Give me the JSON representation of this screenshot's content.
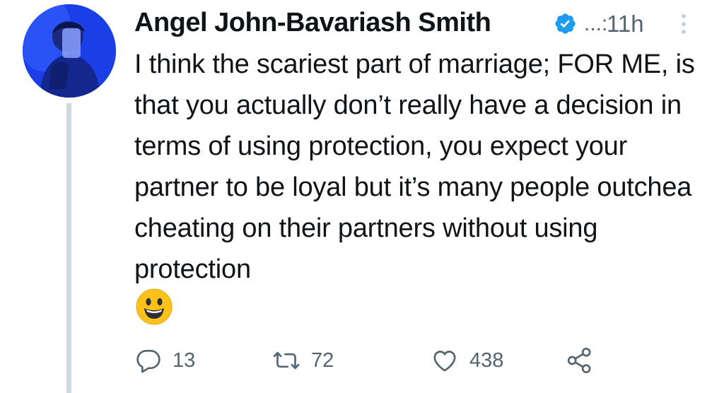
{
  "tweet": {
    "author_name": "Angel John-Bavariash Smith",
    "handle_truncated": "...:",
    "timestamp": "11h",
    "text": "I think the scariest part of marriage; FOR ME, is that you actually don’t really have a decision in terms of using protection, you expect your partner to be loyal but it’s many people outchea cheating on their partners without using protection",
    "emoji": "smiling-face-emoji"
  },
  "actions": {
    "reply_count": "13",
    "retweet_count": "72",
    "like_count": "438"
  },
  "colors": {
    "text": "#0f1419",
    "muted": "#536471",
    "verified": "#1d9bf0",
    "thread_line": "#cfd9de",
    "avatar_bg": "#1a3ee8"
  },
  "icons": {
    "reply": "reply-icon",
    "retweet": "retweet-icon",
    "like": "heart-icon",
    "share": "share-icon",
    "verified": "verified-badge-icon",
    "more": "more-options-icon"
  }
}
